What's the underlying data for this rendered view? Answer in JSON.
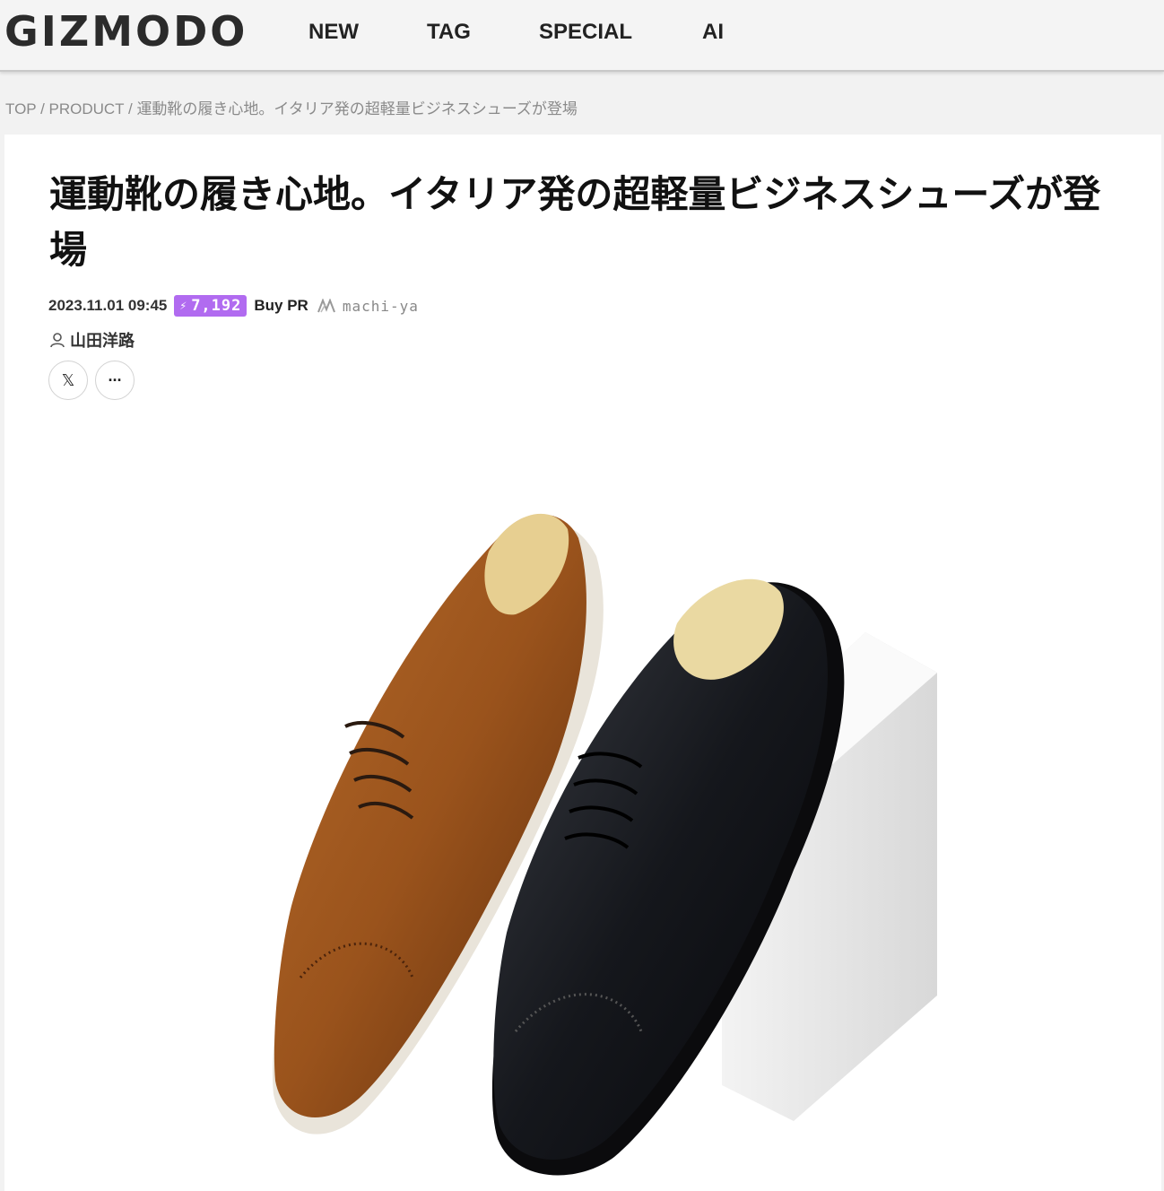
{
  "header": {
    "logo": "GIZMODO",
    "nav": [
      "NEW",
      "TAG",
      "SPECIAL",
      "AI"
    ]
  },
  "breadcrumb": {
    "top": "TOP",
    "section": "PRODUCT",
    "current": "運動靴の履き心地。イタリア発の超軽量ビジネスシューズが登場",
    "separator": " / "
  },
  "article": {
    "title": "運動靴の履き心地。イタリア発の超軽量ビジネスシューズが登場",
    "date": "2023.11.01 09:45",
    "views": "7,192",
    "tag": "Buy PR",
    "sponsor": "machi-ya",
    "author": "山田洋路",
    "share_x": "𝕏",
    "share_more": "···"
  },
  "colors": {
    "badge": "#b16bf0",
    "background": "#f2f2f2",
    "card": "#ffffff"
  }
}
